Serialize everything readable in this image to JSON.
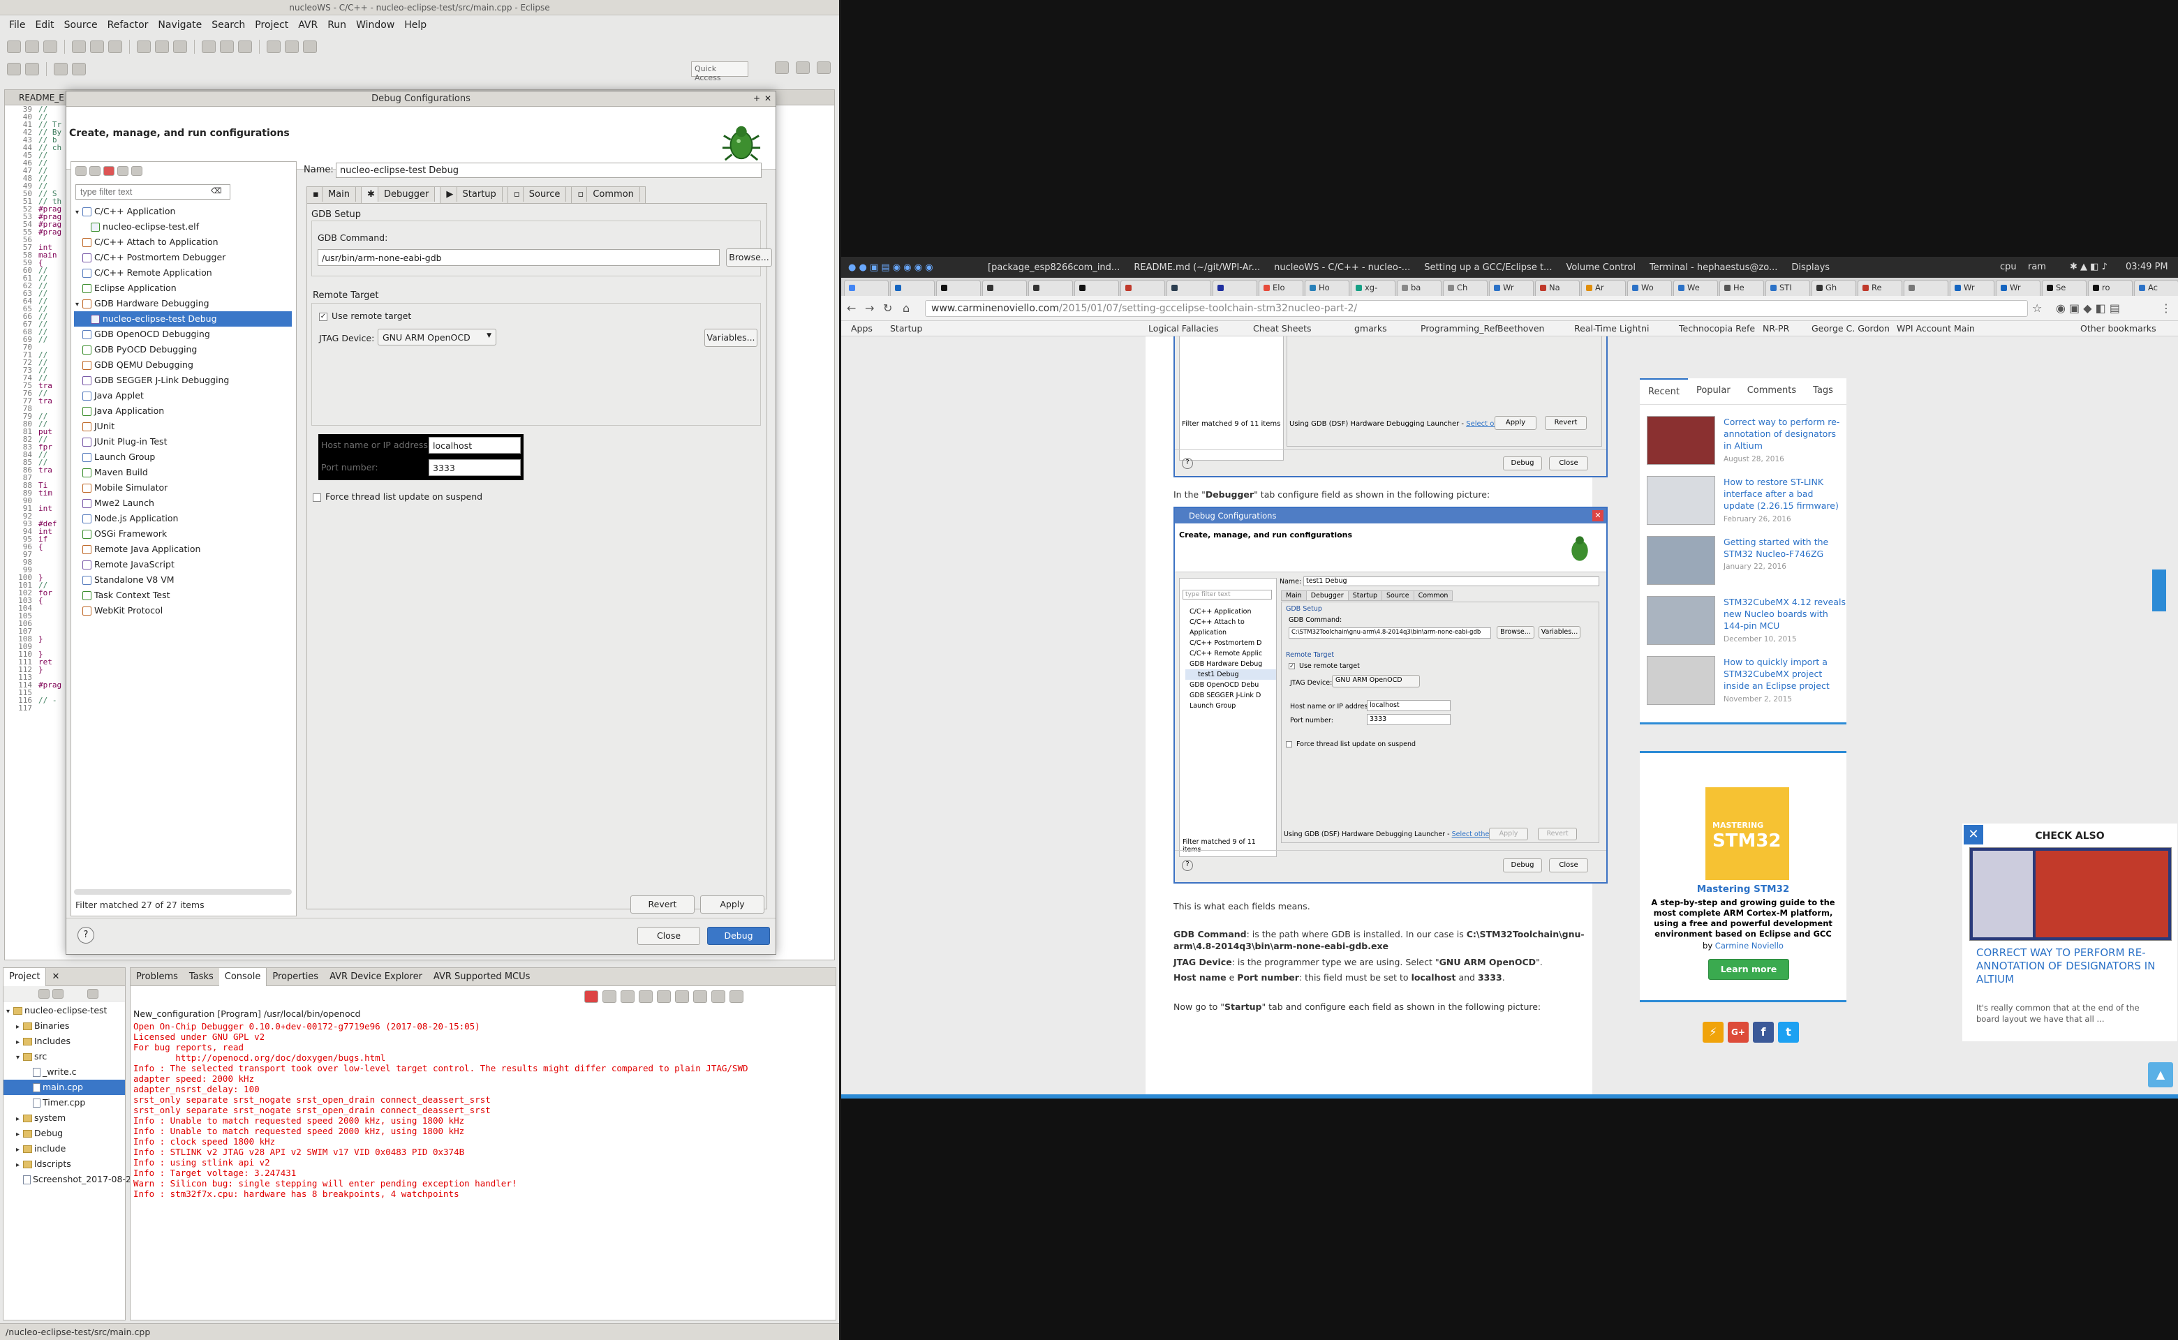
{
  "eclipse": {
    "window_title": "nucleoWS - C/C++ - nucleo-eclipse-test/src/main.cpp - Eclipse",
    "menu": [
      "File",
      "Edit",
      "Source",
      "Refactor",
      "Navigate",
      "Search",
      "Project",
      "AVR",
      "Run",
      "Window",
      "Help"
    ],
    "quick_access": "Quick Access",
    "editor_tab": "README_E",
    "line_numbers": [
      "39",
      "40",
      "41",
      "42",
      "43",
      "44",
      "45",
      "46",
      "47",
      "48",
      "49",
      "50",
      "51",
      "52",
      "53",
      "54",
      "55",
      "56",
      "57",
      "58",
      "59",
      "60",
      "61",
      "62",
      "63",
      "64",
      "65",
      "66",
      "67",
      "68",
      "69",
      "70",
      "71",
      "72",
      "73",
      "74",
      "75",
      "76",
      "77",
      "78",
      "79",
      "80",
      "81",
      "82",
      "83",
      "84",
      "85",
      "86",
      "87",
      "88",
      "89",
      "90",
      "91",
      "92",
      "93",
      "94",
      "95",
      "96",
      "97",
      "98",
      "99",
      "100",
      "101",
      "102",
      "103",
      "104",
      "105",
      "106",
      "107",
      "108",
      "109",
      "110",
      "111",
      "112",
      "113",
      "114",
      "115",
      "116",
      "117"
    ],
    "code_lines": [
      "// ",
      "// ",
      "// Tr",
      "// By",
      "// b",
      "// ch",
      "// ",
      "// ",
      "// ",
      "// ",
      "// ",
      "// S",
      "// th",
      "#prag",
      "#prag",
      "#prag",
      "#prag",
      "",
      "int",
      "main",
      "{",
      "//",
      "//",
      "//",
      "//",
      "//",
      "//",
      "//",
      "//",
      "//",
      "//",
      "",
      "//",
      "//",
      "//",
      "//",
      "tra",
      "//",
      "tra",
      "",
      "//",
      "//",
      "put",
      "//",
      "fpr",
      "//",
      "//",
      "tra",
      "",
      "Ti",
      "tim",
      "",
      "int",
      "",
      "#def",
      "int",
      "if",
      "{",
      "",
      "",
      "",
      "}",
      "//",
      "for",
      "{",
      "",
      "",
      "",
      "",
      "}",
      "",
      "}",
      "ret",
      "}",
      "",
      "#prag",
      "",
      "// -",
      ""
    ],
    "bottom_left_tabs": [
      "Project",
      ""
    ],
    "project_tree": [
      {
        "label": "nucleo-eclipse-test",
        "level": 0,
        "kind": "project"
      },
      {
        "label": "Binaries",
        "level": 1,
        "kind": "folder"
      },
      {
        "label": "Includes",
        "level": 1,
        "kind": "folder"
      },
      {
        "label": "src",
        "level": 1,
        "kind": "folder"
      },
      {
        "label": "_write.c",
        "level": 2,
        "kind": "file"
      },
      {
        "label": "main.cpp",
        "level": 2,
        "kind": "file",
        "selected": true
      },
      {
        "label": "Timer.cpp",
        "level": 2,
        "kind": "file"
      },
      {
        "label": "system",
        "level": 1,
        "kind": "folder"
      },
      {
        "label": "Debug",
        "level": 1,
        "kind": "folder"
      },
      {
        "label": "include",
        "level": 1,
        "kind": "folder"
      },
      {
        "label": "ldscripts",
        "level": 1,
        "kind": "folder"
      },
      {
        "label": "Screenshot_2017-08-2",
        "level": 1,
        "kind": "file"
      }
    ],
    "console_tabs": [
      "Problems",
      "Tasks",
      "Console",
      "Properties",
      "AVR Device Explorer",
      "AVR Supported MCUs"
    ],
    "console_header": "New_configuration [Program] /usr/local/bin/openocd",
    "console_lines": [
      "Open On-Chip Debugger 0.10.0+dev-00172-g7719e96 (2017-08-20-15:05)",
      "Licensed under GNU GPL v2",
      "For bug reports, read",
      "        http://openocd.org/doc/doxygen/bugs.html",
      "Info : The selected transport took over low-level target control. The results might differ compared to plain JTAG/SWD",
      "adapter speed: 2000 kHz",
      "adapter_nsrst_delay: 100",
      "srst_only separate srst_nogate srst_open_drain connect_deassert_srst",
      "srst_only separate srst_nogate srst_open_drain connect_deassert_srst",
      "Info : Unable to match requested speed 2000 kHz, using 1800 kHz",
      "Info : Unable to match requested speed 2000 kHz, using 1800 kHz",
      "Info : clock speed 1800 kHz",
      "Info : STLINK v2 JTAG v28 API v2 SWIM v17 VID 0x0483 PID 0x374B",
      "Info : using stlink api v2",
      "Info : Target voltage: 3.247431",
      "Warn : Silicon bug: single stepping will enter pending exception handler!",
      "Info : stm32f7x.cpu: hardware has 8 breakpoints, 4 watchpoints"
    ],
    "status_path": "/nucleo-eclipse-test/src/main.cpp"
  },
  "dialog": {
    "title": "Debug Configurations",
    "heading": "Create, manage, and run configurations",
    "filter_placeholder": "type filter text",
    "configs": [
      {
        "label": "C/C++ Application",
        "level": 0,
        "expanded": true
      },
      {
        "label": "nucleo-eclipse-test.elf",
        "level": 1
      },
      {
        "label": "C/C++ Attach to Application",
        "level": 0
      },
      {
        "label": "C/C++ Postmortem Debugger",
        "level": 0
      },
      {
        "label": "C/C++ Remote Application",
        "level": 0
      },
      {
        "label": "Eclipse Application",
        "level": 0
      },
      {
        "label": "GDB Hardware Debugging",
        "level": 0,
        "expanded": true
      },
      {
        "label": "nucleo-eclipse-test Debug",
        "level": 1,
        "selected": true
      },
      {
        "label": "GDB OpenOCD Debugging",
        "level": 0
      },
      {
        "label": "GDB PyOCD Debugging",
        "level": 0
      },
      {
        "label": "GDB QEMU Debugging",
        "level": 0
      },
      {
        "label": "GDB SEGGER J-Link Debugging",
        "level": 0
      },
      {
        "label": "Java Applet",
        "level": 0
      },
      {
        "label": "Java Application",
        "level": 0
      },
      {
        "label": "JUnit",
        "level": 0
      },
      {
        "label": "JUnit Plug-in Test",
        "level": 0
      },
      {
        "label": "Launch Group",
        "level": 0
      },
      {
        "label": "Maven Build",
        "level": 0
      },
      {
        "label": "Mobile Simulator",
        "level": 0
      },
      {
        "label": "Mwe2 Launch",
        "level": 0
      },
      {
        "label": "Node.js Application",
        "level": 0
      },
      {
        "label": "OSGi Framework",
        "level": 0
      },
      {
        "label": "Remote Java Application",
        "level": 0
      },
      {
        "label": "Remote JavaScript",
        "level": 0
      },
      {
        "label": "Standalone V8 VM",
        "level": 0
      },
      {
        "label": "Task Context Test",
        "level": 0
      },
      {
        "label": "WebKit Protocol",
        "level": 0
      }
    ],
    "filter_status": "Filter matched 27 of 27 items",
    "name_label": "Name:",
    "name_value": "nucleo-eclipse-test Debug",
    "tabs": [
      "Main",
      "Debugger",
      "Startup",
      "Source",
      "Common"
    ],
    "active_tab": "Debugger",
    "gdb_setup_label": "GDB Setup",
    "gdb_command_label": "GDB Command:",
    "gdb_command_value": "/usr/bin/arm-none-eabi-gdb",
    "browse_label": "Browse...",
    "variables_label": "Variables...",
    "remote_target_label": "Remote Target",
    "use_remote_label": "Use remote target",
    "jtag_label": "JTAG Device:",
    "jtag_value": "GNU ARM OpenOCD",
    "host_label": "Host name or IP address:",
    "host_value": "localhost",
    "port_label": "Port number:",
    "port_value": "3333",
    "force_thread_label": "Force thread list update on suspend",
    "revert_label": "Revert",
    "apply_label": "Apply",
    "close_label": "Close",
    "debug_label": "Debug",
    "help_glyph": "?"
  },
  "chrome": {
    "tasks": [
      "[package_esp8266com_ind...",
      "README.md (~/git/WPI-Ar...",
      "nucleoWS - C/C++ - nucleo-...",
      "Setting up a GCC/Eclipse t...",
      "Volume Control",
      "Terminal - hephaestus@zo...",
      "Displays"
    ],
    "tray": [
      "cpu",
      "ram"
    ],
    "clock": "03:49 PM",
    "tab_titles": [
      "",
      "",
      "",
      "",
      "",
      "",
      "",
      "",
      "",
      "Elo",
      "Ho",
      "xg-",
      "ba",
      "Ch",
      "Wr",
      "Na",
      "Ar",
      "Wo",
      "We",
      "He",
      "STI",
      "Gh",
      "Re",
      "",
      "Wr",
      "Wr",
      "Se",
      "ro",
      "Ac"
    ],
    "url_host": "www.carminenoviello.com",
    "url_path": "/2015/01/07/setting-gccelipse-toolchain-stm32nucleo-part-2/",
    "bookmarks": [
      "Apps",
      "Startup",
      "Logical Fallacies",
      "Cheat Sheets",
      "gmarks",
      "Programming_Ref",
      "Beethoven",
      "Real-Time Lightni",
      "Technocopia Refe",
      "NR-PR",
      "George C. Gordon",
      "WPI Account Main",
      "Other bookmarks"
    ],
    "article": {
      "top_shot_filter": "Filter matched 9 of 11 items",
      "top_shot_launcher": "Using GDB (DSF) Hardware Debugging Launcher - ",
      "top_shot_launcher_link": "Select other...",
      "top_shot_apply": "Apply",
      "top_shot_revert": "Revert",
      "top_shot_debug": "Debug",
      "top_shot_close": "Close",
      "para1_pre": "In the \"",
      "para1_bold": "Debugger",
      "para1_post": "\" tab configure field as shown in the following picture:",
      "shot_title": "Debug Configurations",
      "shot_heading": "Create, manage, and run configurations",
      "shot_name_value": "test1 Debug",
      "shot_tabs": [
        "Main",
        "Debugger",
        "Startup",
        "Source",
        "Common"
      ],
      "shot_tree": [
        "C/C++ Application",
        "C/C++ Attach to Application",
        "C/C++ Postmortem D",
        "C/C++ Remote Applic",
        "GDB Hardware Debug",
        "test1 Debug",
        "GDB OpenOCD Debu",
        "GDB SEGGER J-Link D",
        "Launch Group"
      ],
      "shot_gdb": "C:\\STM32Toolchain\\gnu-arm\\4.8-2014q3\\bin\\arm-none-eabi-gdb",
      "shot_host": "localhost",
      "shot_port": "3333",
      "shot_jtag": "GNU ARM OpenOCD",
      "shot_filter": "Filter matched 9 of 11 items",
      "shot_launcher": "Using GDB (DSF) Hardware Debugging Launcher - ",
      "shot_launcher_link": "Select other...",
      "para2": "This is what each fields means.",
      "gdb_cmd_bold": "GDB Command",
      "gdb_cmd_text": ": is the path where GDB is installed. In our case is ",
      "gdb_cmd_path": "C:\\STM32Toolchain\\gnu-arm\\4.8-2014q3\\bin\\arm-none-eabi-gdb.exe",
      "jtag_bold": "JTAG Device",
      "jtag_text": ": is the programmer type we are using. Select \"",
      "jtag_val": "GNU ARM OpenOCD",
      "host_bold": "Host name",
      "host_text": " e ",
      "port_bold": "Port number",
      "host_text2": ": this field must be set to ",
      "host_val": "localhost",
      "and": " and ",
      "port_val": "3333",
      "para3_pre": "Now go to \"",
      "para3_bold": "Startup",
      "para3_post": "\" tab and configure each field as shown in the following picture:"
    },
    "sidebar": {
      "tabs": [
        "Recent",
        "Popular",
        "Comments",
        "Tags"
      ],
      "recent": [
        {
          "title": "Correct way to perform re-annotation of designators in Altium",
          "date": "August 28, 2016"
        },
        {
          "title": "How to restore ST-LINK interface after a bad update (2.26.15 firmware)",
          "date": "February 26, 2016"
        },
        {
          "title": "Getting started with the STM32 Nucleo-F746ZG",
          "date": "January 22, 2016"
        },
        {
          "title": "STM32CubeMX 4.12 reveals new Nucleo boards with 144-pin MCU",
          "date": "December 10, 2015"
        },
        {
          "title": "How to quickly import a STM32CubeMX project inside an Eclipse project",
          "date": "November 2, 2015"
        }
      ],
      "book_title": "Mastering STM32",
      "book_desc": "A step-by-step and growing guide to the most complete ARM Cortex-M platform, using a free and powerful development environment based on Eclipse and GCC",
      "book_by": "by ",
      "book_author": "Carmine Noviello",
      "learn_more": "Learn more",
      "book_cover_big": "MASTERING",
      "book_cover_stm": "STM32",
      "social": [
        "⚡",
        "G+",
        "f",
        "t"
      ]
    },
    "check_also": {
      "heading": "CHECK ALSO",
      "title": "CORRECT WAY TO PERFORM RE-ANNOTATION OF DESIGNATORS IN ALTIUM",
      "text": "It's really common that at the end of the board layout we have that all ..."
    }
  }
}
